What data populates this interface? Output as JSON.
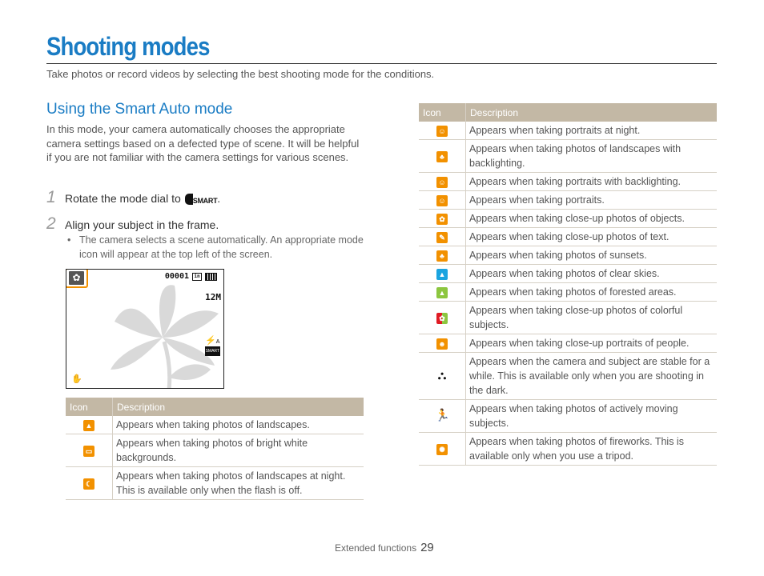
{
  "header": {
    "title": "Shooting modes",
    "subtitle": "Take photos or record videos by selecting the best shooting mode for the conditions."
  },
  "section": {
    "heading": "Using the Smart Auto mode",
    "intro": "In this mode, your camera automatically chooses the appropriate camera settings based on a defected type of scene. It will be helpful if you are not familiar with the camera settings for various scenes."
  },
  "steps": [
    {
      "number": "1",
      "text": "Rotate the mode dial to",
      "icon_label": "SMART",
      "suffix": "."
    },
    {
      "number": "2",
      "text": "Align your subject in the frame.",
      "bullet": "The camera selects a scene automatically. An appropriate mode icon will appear at the top left of the screen."
    }
  ],
  "preview": {
    "mode_icon": "macro-flower-icon",
    "counter": "00001",
    "resolution": "12M",
    "flash_label": "A",
    "colors": {
      "highlight": "#f29100"
    }
  },
  "tables": {
    "header_icon": "Icon",
    "header_description": "Description",
    "left_rows": [
      {
        "icon": "landscape-icon",
        "glyph": "▲",
        "color": "orange",
        "description": "Appears when taking photos of landscapes."
      },
      {
        "icon": "white-background-icon",
        "glyph": "▭",
        "color": "orange",
        "description": "Appears when taking photos of bright white backgrounds."
      },
      {
        "icon": "night-landscape-icon",
        "glyph": "☾",
        "color": "orange",
        "description": "Appears when taking photos of landscapes at night. This is available only when the flash is off."
      }
    ],
    "right_rows": [
      {
        "icon": "night-portrait-icon",
        "glyph": "☺",
        "color": "orange",
        "description": "Appears when taking portraits at night."
      },
      {
        "icon": "backlit-landscape-icon",
        "glyph": "♣",
        "color": "orange",
        "description": "Appears when taking photos of landscapes with backlighting."
      },
      {
        "icon": "backlit-portrait-icon",
        "glyph": "☺",
        "color": "orange",
        "description": "Appears when taking portraits with backlighting."
      },
      {
        "icon": "portrait-icon",
        "glyph": "☺",
        "color": "orange",
        "description": "Appears when taking portraits."
      },
      {
        "icon": "macro-icon",
        "glyph": "✿",
        "color": "orange",
        "description": "Appears when taking close-up photos of objects."
      },
      {
        "icon": "macro-text-icon",
        "glyph": "✎",
        "color": "orange",
        "description": "Appears when taking close-up photos of text."
      },
      {
        "icon": "sunset-icon",
        "glyph": "♣",
        "color": "orange",
        "description": "Appears when taking photos of sunsets."
      },
      {
        "icon": "clear-sky-icon",
        "glyph": "▲",
        "color": "blue",
        "description": "Appears when taking photos of clear skies."
      },
      {
        "icon": "forest-icon",
        "glyph": "▲",
        "color": "green",
        "description": "Appears when taking photos of forested areas."
      },
      {
        "icon": "macro-color-icon",
        "glyph": "✿",
        "color": "multi",
        "description": "Appears when taking close-up photos of colorful subjects."
      },
      {
        "icon": "macro-portrait-icon",
        "glyph": "☻",
        "color": "orange",
        "description": "Appears when taking close-up portraits of people."
      },
      {
        "icon": "tripod-icon",
        "glyph": "⛬",
        "color": "plain",
        "description": "Appears when the camera and subject are stable for a while. This is available only when you are shooting in the dark."
      },
      {
        "icon": "action-icon",
        "glyph": "🏃",
        "color": "plain",
        "description": "Appears when taking photos of actively moving subjects."
      },
      {
        "icon": "fireworks-icon",
        "glyph": "✺",
        "color": "orange",
        "description": "Appears when taking photos of fireworks. This is available only when you use a tripod."
      }
    ]
  },
  "footer": {
    "section": "Extended functions",
    "page": "29"
  }
}
